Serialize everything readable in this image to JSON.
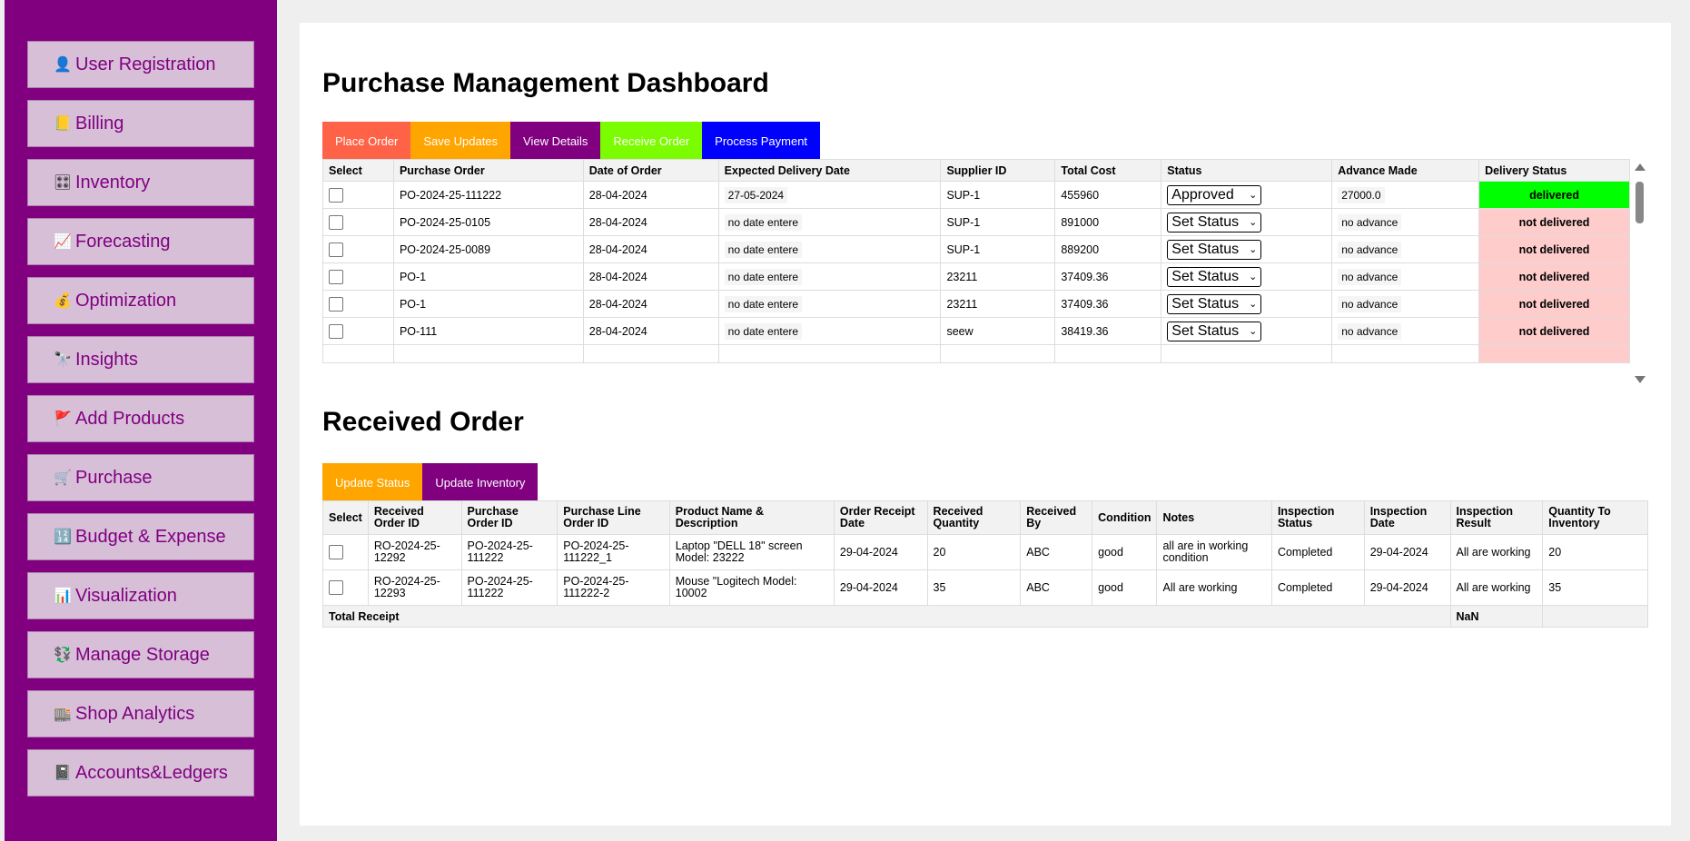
{
  "sidebar": {
    "items": [
      {
        "label": "User Registration",
        "icon": "user-icon",
        "glyph": "👤"
      },
      {
        "label": "Billing",
        "icon": "notebook-icon",
        "glyph": "📒"
      },
      {
        "label": "Inventory",
        "icon": "sliders-icon",
        "glyph": "🎛"
      },
      {
        "label": "Forecasting",
        "icon": "chart-up-icon",
        "glyph": "📈"
      },
      {
        "label": "Optimization",
        "icon": "money-bag-icon",
        "glyph": "💰"
      },
      {
        "label": "Insights",
        "icon": "telescope-icon",
        "glyph": "🔭"
      },
      {
        "label": "Add Products",
        "icon": "flag-icon",
        "glyph": "🚩"
      },
      {
        "label": "Purchase",
        "icon": "cart-icon",
        "glyph": "🛒"
      },
      {
        "label": "Budget & Expense",
        "icon": "numbers-icon",
        "glyph": "🔢"
      },
      {
        "label": "Visualization",
        "icon": "bar-chart-icon",
        "glyph": "📊"
      },
      {
        "label": "Manage Storage",
        "icon": "currency-exchange-icon",
        "glyph": "💱"
      },
      {
        "label": "Shop Analytics",
        "icon": "department-store-icon",
        "glyph": "🏬"
      },
      {
        "label": "Accounts&Ledgers",
        "icon": "book-icon",
        "glyph": "📓"
      }
    ]
  },
  "main": {
    "title": "Purchase Management Dashboard",
    "po_buttons": [
      {
        "label": "Place Order",
        "color": "#ff6347"
      },
      {
        "label": "Save Updates",
        "color": "#ffa500"
      },
      {
        "label": "View Details",
        "color": "#800080"
      },
      {
        "label": "Receive Order",
        "color": "#7cfc00"
      },
      {
        "label": "Process Payment",
        "color": "#0000ff"
      }
    ],
    "po_table": {
      "headers": [
        "Select",
        "Purchase Order",
        "Date of Order",
        "Expected Delivery Date",
        "Supplier ID",
        "Total Cost",
        "Status",
        "Advance Made",
        "Delivery Status"
      ],
      "rows": [
        {
          "po": "PO-2024-25-111222",
          "date": "28-04-2024",
          "expected": "27-05-2024",
          "supplier": "SUP-1",
          "cost": "455960",
          "status": "Approved",
          "advance": "27000.0",
          "delivery": "delivered"
        },
        {
          "po": "PO-2024-25-0105",
          "date": "28-04-2024",
          "expected": "no date entere",
          "supplier": "SUP-1",
          "cost": "891000",
          "status": "Set Status",
          "advance": "no advance",
          "delivery": "not delivered"
        },
        {
          "po": "PO-2024-25-0089",
          "date": "28-04-2024",
          "expected": "no date entere",
          "supplier": "SUP-1",
          "cost": "889200",
          "status": "Set Status",
          "advance": "no advance",
          "delivery": "not delivered"
        },
        {
          "po": "PO-1",
          "date": "28-04-2024",
          "expected": "no date entere",
          "supplier": "23211",
          "cost": "37409.36",
          "status": "Set Status",
          "advance": "no advance",
          "delivery": "not delivered"
        },
        {
          "po": "PO-1",
          "date": "28-04-2024",
          "expected": "no date entere",
          "supplier": "23211",
          "cost": "37409.36",
          "status": "Set Status",
          "advance": "no advance",
          "delivery": "not delivered"
        },
        {
          "po": "PO-111",
          "date": "28-04-2024",
          "expected": "no date entere",
          "supplier": "seew",
          "cost": "38419.36",
          "status": "Set Status",
          "advance": "no advance",
          "delivery": "not delivered"
        }
      ]
    },
    "received_title": "Received Order",
    "ro_buttons": [
      {
        "label": "Update Status",
        "color": "#ffa500"
      },
      {
        "label": "Update Inventory",
        "color": "#800080"
      }
    ],
    "ro_table": {
      "headers": [
        "Select",
        "Received Order ID",
        "Purchase Order ID",
        "Purchase Line Order ID",
        "Product Name & Description",
        "Order Receipt Date",
        "Received Quantity",
        "Received By",
        "Condition",
        "Notes",
        "Inspection Status",
        "Inspection Date",
        "Inspection Result",
        "Quantity To Inventory"
      ],
      "rows": [
        {
          "ro": "RO-2024-25-12292",
          "po": "PO-2024-25-111222",
          "line": "PO-2024-25-111222_1",
          "product": "Laptop \"DELL 18\" screen Model: 23222",
          "receipt": "29-04-2024",
          "qty": "20",
          "by": "ABC",
          "condition": "good",
          "notes": "all are in working condition",
          "insp_status": "Completed",
          "insp_date": "29-04-2024",
          "insp_result": "All are working",
          "to_inv": "20"
        },
        {
          "ro": "RO-2024-25-12293",
          "po": "PO-2024-25-111222",
          "line": "PO-2024-25-111222-2",
          "product": "Mouse \"Logitech Model: 10002",
          "receipt": "29-04-2024",
          "qty": "35",
          "by": "ABC",
          "condition": "good",
          "notes": "All are working",
          "insp_status": "Completed",
          "insp_date": "29-04-2024",
          "insp_result": "All are working",
          "to_inv": "35"
        }
      ],
      "total_label": "Total Receipt",
      "total_value": "NaN"
    }
  }
}
